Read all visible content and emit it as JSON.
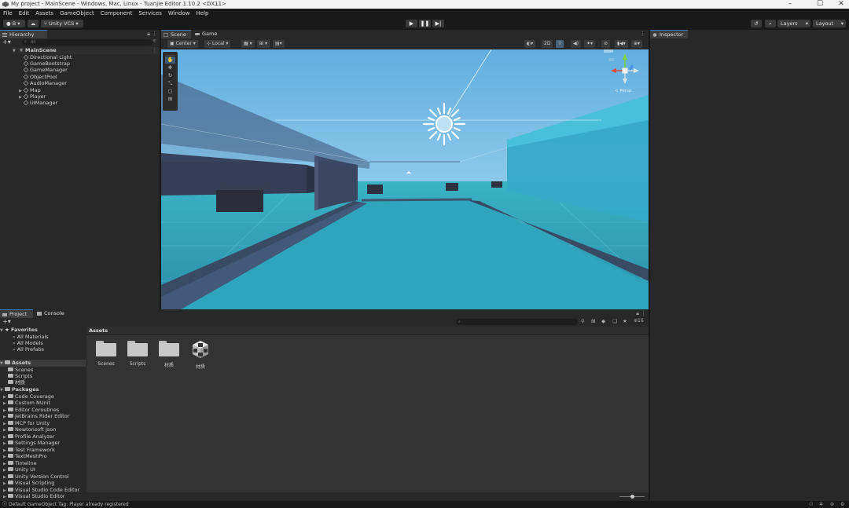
{
  "window": {
    "title": "My project - MainScene - Windows, Mac, Linux - Tuanjie Editor 1.10.2 <DX11>",
    "controls": [
      "–",
      "☐",
      "✕"
    ]
  },
  "menu": [
    "File",
    "Edit",
    "Assets",
    "GameObject",
    "Component",
    "Services",
    "Window",
    "Help"
  ],
  "toolbar": {
    "account": "B",
    "vcs": "Unity VCS",
    "layers": "Layers",
    "layout": "Layout"
  },
  "hierarchy": {
    "tab": "Hierarchy",
    "search_placeholder": "All",
    "scene": "MainScene",
    "items": [
      {
        "label": "Directional Light",
        "expandable": false
      },
      {
        "label": "GameBootstrap",
        "expandable": false
      },
      {
        "label": "GameManager",
        "expandable": false
      },
      {
        "label": "ObjectPool",
        "expandable": false
      },
      {
        "label": "AudioManager",
        "expandable": false
      },
      {
        "label": "Map",
        "expandable": true
      },
      {
        "label": "Player",
        "expandable": true
      },
      {
        "label": "UIManager",
        "expandable": false
      }
    ]
  },
  "scene_view": {
    "tabs": [
      "Scene",
      "Game"
    ],
    "pivot": "Center",
    "space": "Local",
    "mode_2d": "2D",
    "gizmo_label": "< Persp"
  },
  "inspector": {
    "tab": "Inspector"
  },
  "project": {
    "tabs": [
      "Project",
      "Console"
    ],
    "hidden_count": "16",
    "favorites_label": "Favorites",
    "favorites": [
      "All Materials",
      "All Models",
      "All Prefabs"
    ],
    "assets_label": "Assets",
    "asset_folders": [
      "Scenes",
      "Scripts",
      "材质"
    ],
    "packages_label": "Packages",
    "packages": [
      "Code Coverage",
      "Custom NUnit",
      "Editor Coroutines",
      "JetBrains Rider Editor",
      "MCP for Unity",
      "Newtonsoft Json",
      "Profile Analyzer",
      "Settings Manager",
      "Test Framework",
      "TextMeshPro",
      "Timeline",
      "Unity UI",
      "Unity Version Control",
      "Visual Scripting",
      "Visual Studio Code Editor",
      "Visual Studio Editor"
    ],
    "breadcrumb": "Assets",
    "grid_items": [
      {
        "label": "Scenes",
        "kind": "folder"
      },
      {
        "label": "Scripts",
        "kind": "folder"
      },
      {
        "label": "材质",
        "kind": "folder"
      },
      {
        "label": "材质",
        "kind": "package-asset"
      }
    ]
  },
  "status": {
    "message": "Default GameObject Tag: Player already registered"
  },
  "colors": {
    "accent": "#3a79bb",
    "panel": "#282828",
    "background": "#191919",
    "sky_top": "#6ab3e2",
    "floor": "#2a95b0"
  }
}
